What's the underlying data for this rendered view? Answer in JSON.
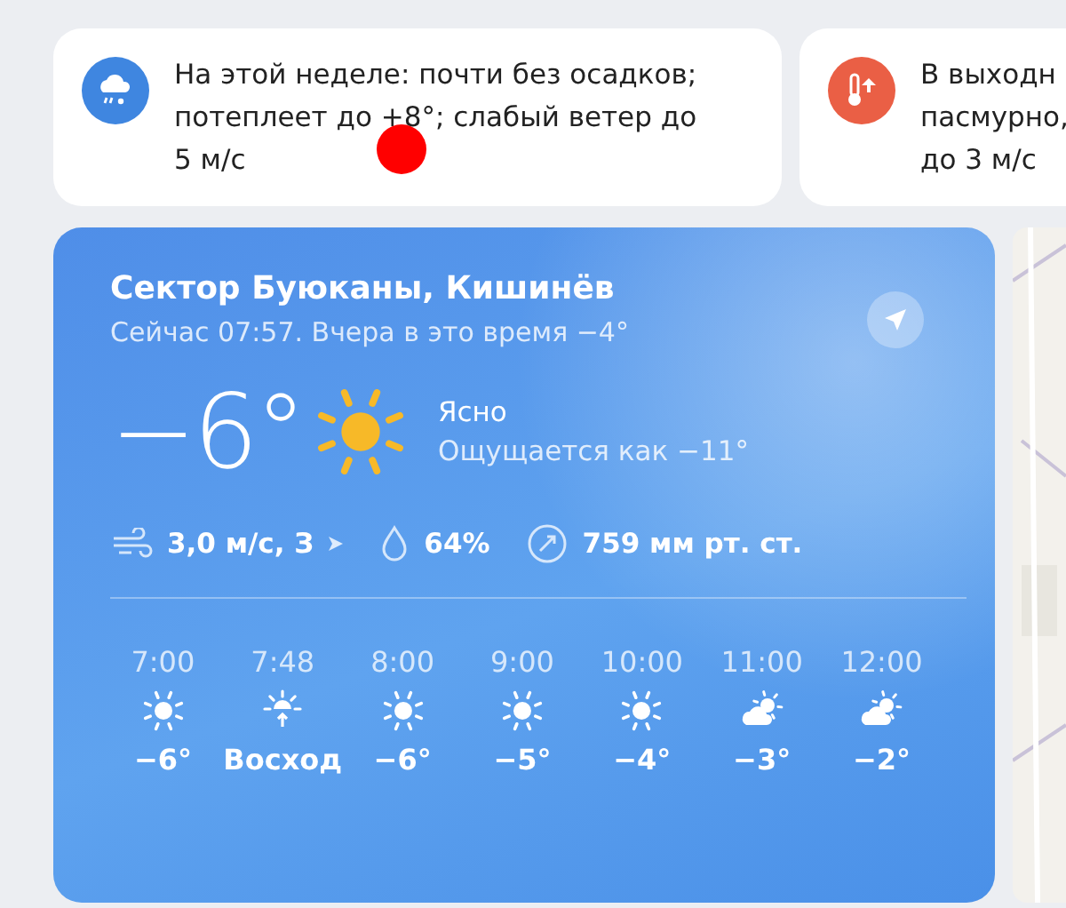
{
  "summary_cards": [
    {
      "kind": "precipitation",
      "lines": [
        "На этой неделе: почти без осадков;",
        "потеплеет до +8°; слабый ветер до",
        "5 м/с"
      ]
    },
    {
      "kind": "warming",
      "lines": [
        "В выходн",
        "пасмурно,",
        "до 3 м/с"
      ]
    }
  ],
  "annotation": {
    "kind": "dot"
  },
  "weather": {
    "location": "Сектор Буюканы, Кишинёв",
    "subtitle": "Сейчас 07:57. Вчера в это время −4°",
    "temperature": "−6°",
    "kind": "sun",
    "condition": "Ясно",
    "feels_like": "Ощущается как −11°",
    "details": [
      {
        "kind": "wind",
        "value": "3,0 м/с, З"
      },
      {
        "kind": "humidity",
        "value": "64%"
      },
      {
        "kind": "pressure",
        "value": "759 мм рт. ст."
      }
    ],
    "hourly": [
      {
        "time": "7:00",
        "kind": "sun",
        "value": "−6°"
      },
      {
        "time": "7:48",
        "kind": "sunrise",
        "value": "Восход"
      },
      {
        "time": "8:00",
        "kind": "sun",
        "value": "−6°"
      },
      {
        "time": "9:00",
        "kind": "sun",
        "value": "−5°"
      },
      {
        "time": "10:00",
        "kind": "sun",
        "value": "−4°"
      },
      {
        "time": "11:00",
        "kind": "partly_cloudy",
        "value": "−3°"
      },
      {
        "time": "12:00",
        "kind": "partly_cloudy",
        "value": "−2°"
      }
    ]
  }
}
